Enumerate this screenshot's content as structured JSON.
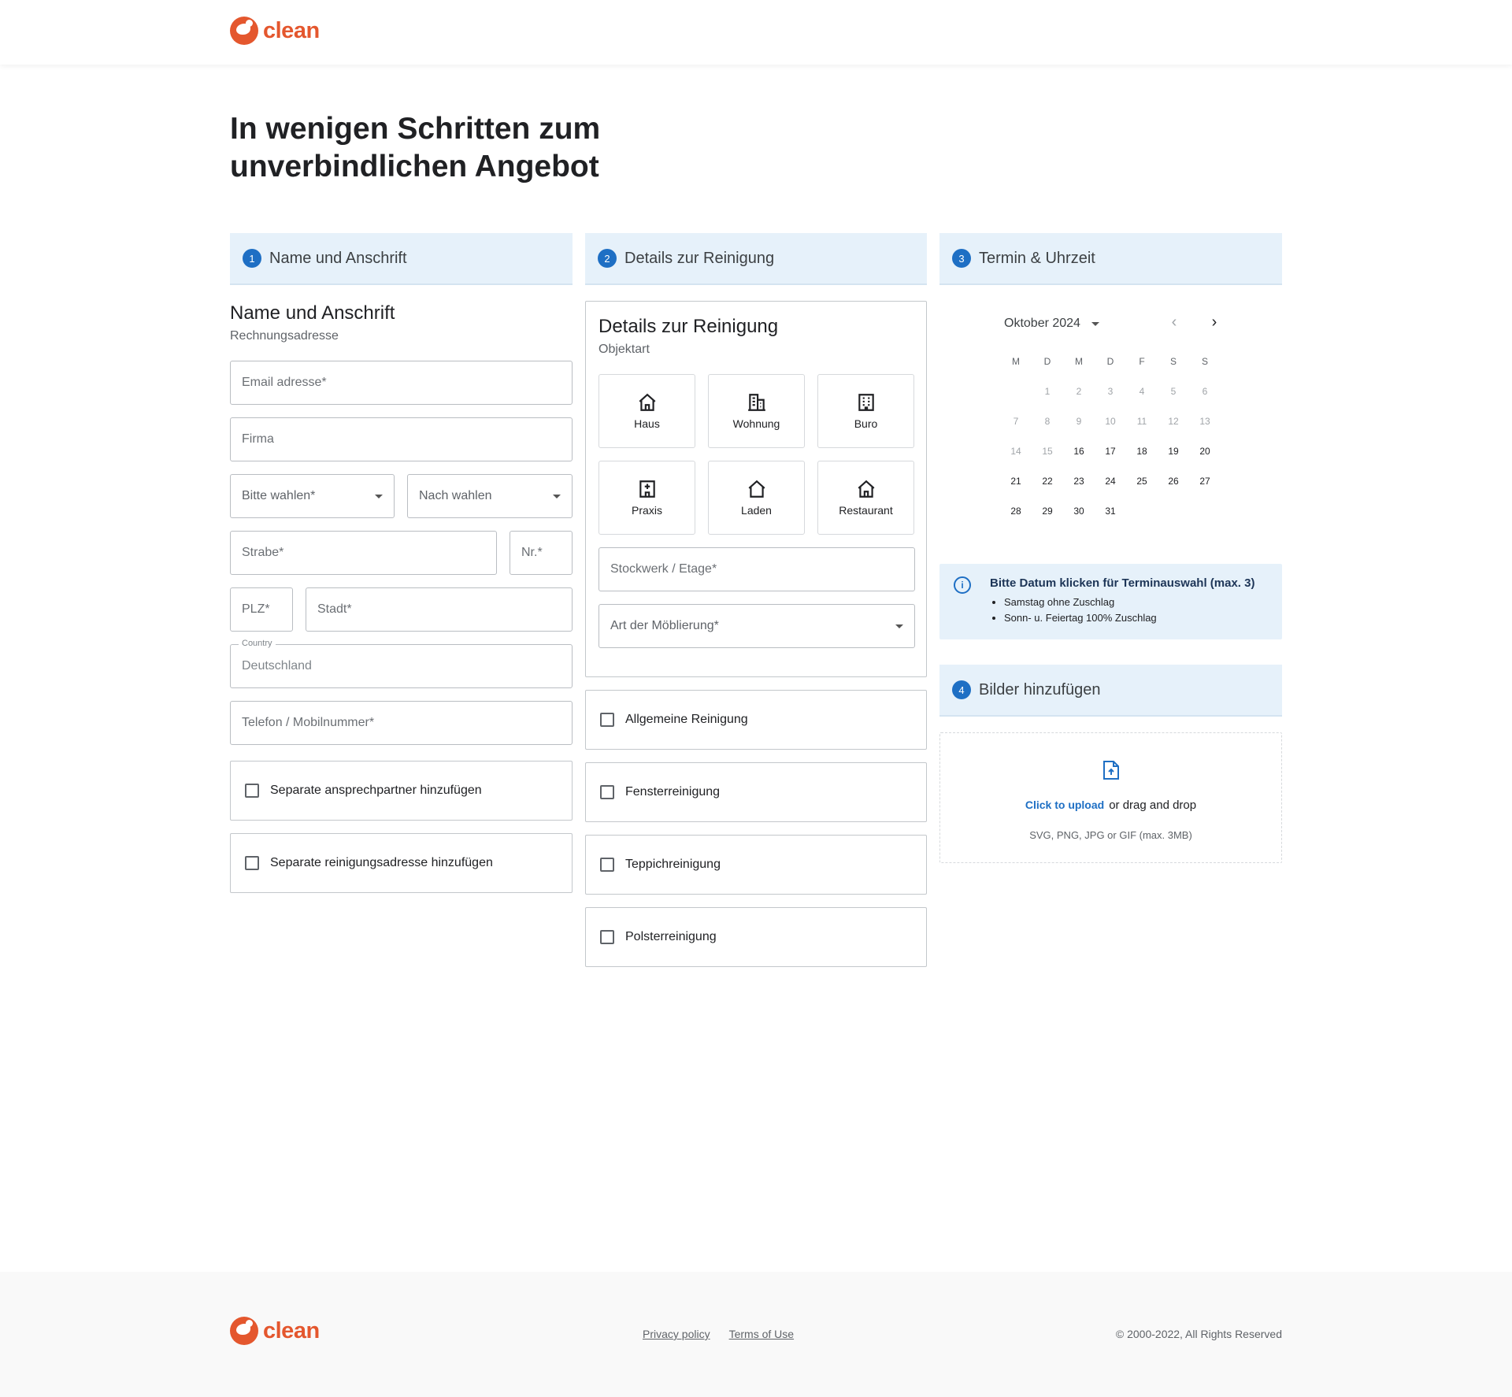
{
  "brand": {
    "name": "clean",
    "color": "#e4572e"
  },
  "heading": "In wenigen Schritten zum unverbindlichen Angebot",
  "steps": [
    {
      "num": "1",
      "title": "Name und Anschrift"
    },
    {
      "num": "2",
      "title": "Details zur Reinigung"
    },
    {
      "num": "3",
      "title": "Termin & Uhrzeit"
    },
    {
      "num": "4",
      "title": "Bilder hinzufügen"
    }
  ],
  "address": {
    "title": "Name und Anschrift",
    "subtitle": "Rechnungsadresse",
    "email_placeholder": "Email adresse*",
    "company_placeholder": "Firma",
    "salutation_select": "Bitte wahlen*",
    "title_select": "Nach wahlen",
    "street_placeholder": "Strabe*",
    "number_placeholder": "Nr.*",
    "zip_placeholder": "PLZ*",
    "city_placeholder": "Stadt*",
    "country_label": "Country",
    "country_value": "Deutschland",
    "phone_placeholder": "Telefon / Mobilnummer*",
    "checks": [
      "Separate ansprechpartner hinzufügen",
      "Separate reinigungsadresse hinzufügen"
    ]
  },
  "details": {
    "title": "Details zur Reinigung",
    "subtitle": "Objektart",
    "tiles": [
      {
        "label": "Haus",
        "icon": "house-icon"
      },
      {
        "label": "Wohnung",
        "icon": "apartment-icon"
      },
      {
        "label": "Buro",
        "icon": "office-building-icon"
      },
      {
        "label": "Praxis",
        "icon": "clinic-icon"
      },
      {
        "label": "Laden",
        "icon": "shop-icon"
      },
      {
        "label": "Restaurant",
        "icon": "restaurant-icon"
      }
    ],
    "floor_placeholder": "Stockwerk / Etage*",
    "furnishing_select": "Art der Möblierung*",
    "services": [
      "Allgemeine Reinigung",
      "Fensterreinigung",
      "Teppichreinigung",
      "Polsterreinigung"
    ]
  },
  "calendar": {
    "month": "Oktober 2024",
    "weekdays": [
      "M",
      "D",
      "M",
      "D",
      "F",
      "S",
      "S"
    ],
    "leading_blanks": 1,
    "days": 31,
    "first_enabled": 16
  },
  "info": {
    "title": "Bitte Datum klicken für Terminauswahl (max. 3)",
    "items": [
      "Samstag ohne Zuschlag",
      "Sonn- u. Feiertag 100% Zuschlag"
    ]
  },
  "upload": {
    "link": "Click to upload",
    "text": "or drag and drop",
    "hint": "SVG, PNG, JPG or GIF (max. 3MB)"
  },
  "footer": {
    "links": [
      "Privacy policy",
      "Terms of Use"
    ],
    "copyright": "© 2000-2022, All Rights Reserved"
  },
  "colors": {
    "accent": "#1e6fc4",
    "header_bg": "#e6f1fa"
  }
}
